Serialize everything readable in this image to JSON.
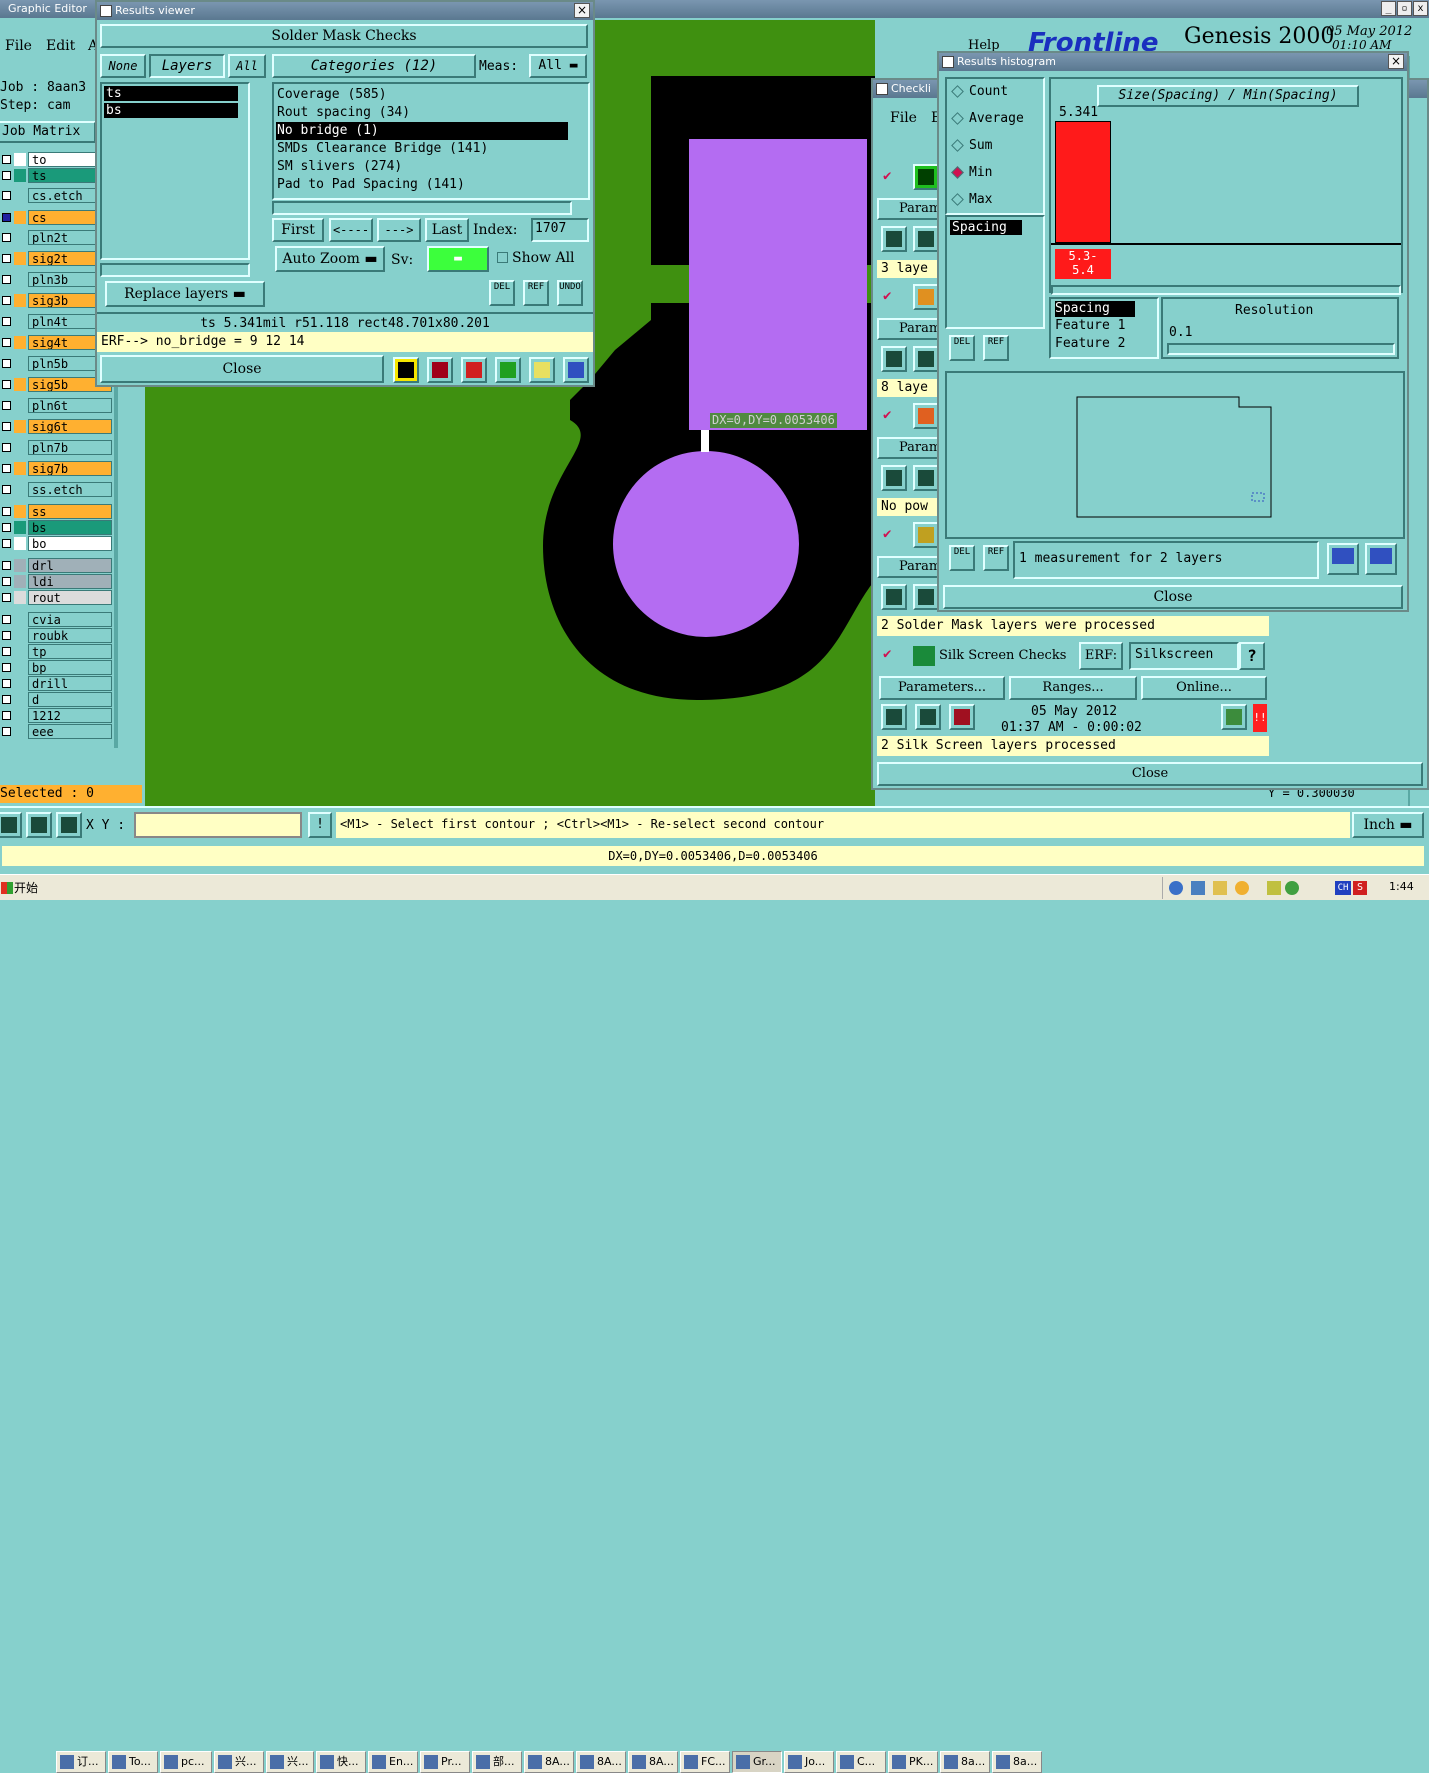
{
  "graphic_editor": {
    "title": "Graphic Editor",
    "menu": [
      "File",
      "Edit",
      "A"
    ],
    "help": "Help",
    "job_label": "Job : 8aan3",
    "step_label": "Step: cam",
    "job_matrix": "Job Matrix",
    "layers": [
      "to",
      "ts",
      "cs.etch",
      "cs",
      "pln2t",
      "sig2t",
      "pln3b",
      "sig3b",
      "pln4t",
      "sig4t",
      "pln5b",
      "sig5b",
      "pln6t",
      "sig6t",
      "pln7b",
      "sig7b",
      "ss.etch",
      "ss",
      "bs",
      "bo",
      "drl",
      "ldi",
      "rout",
      "cvia",
      "roubk",
      "tp",
      "bp",
      "drill",
      "d",
      "1212",
      "eee"
    ],
    "selected_label": "Selected : 0",
    "xy_label": "X Y :",
    "hint": "<M1> - Select first contour ; <Ctrl><M1> - Re-select second contour",
    "units": "Inch",
    "status": "DX=0,DY=0.0053406,D=0.0053406",
    "measure_label": "DX=0,DY=0.0053406",
    "y_readout": "Y = 0.300030",
    "brand": "Frontline",
    "product": "Genesis 2000",
    "date": "05 May 2012",
    "time": "01:10 AM"
  },
  "results_viewer": {
    "title": "Results viewer",
    "heading": "Solder Mask Checks",
    "tabs": {
      "none": "None",
      "layers": "Layers",
      "all": "All"
    },
    "layer_list": [
      "ts",
      "bs"
    ],
    "categories_title": "Categories (12)",
    "meas_label": "Meas:",
    "meas_value": "All",
    "categories": [
      "Coverage (585)",
      "Rout spacing (34)",
      "No bridge (1)",
      "SMDs Clearance Bridge (141)",
      "SM slivers (274)",
      "Pad to Pad Spacing (141)"
    ],
    "nav": {
      "first": "First",
      "prev": "<----",
      "next": "--->",
      "last": "Last",
      "index_label": "Index:",
      "index_value": "1707"
    },
    "auto_zoom": "Auto Zoom",
    "sv_label": "Sv:",
    "show_all": "Show All",
    "replace_layers": "Replace layers",
    "del": "DEL",
    "ref": "REF",
    "undo": "UNDO",
    "info": "ts 5.341mil  r51.118  rect48.701x80.201",
    "erf": "ERF--> no_bridge = 9 12 14",
    "close": "Close"
  },
  "checklist": {
    "title": "Checkli",
    "menu": [
      "File",
      "E"
    ],
    "param": "Param",
    "rows": [
      "3 laye",
      "8 laye",
      "No pow"
    ],
    "sm_status": "2 Solder Mask layers were processed",
    "silk": {
      "label": "Silk Screen Checks",
      "erf": "ERF:",
      "erf_value": "Silkscreen",
      "q": "?"
    },
    "buttons": {
      "parameters": "Parameters...",
      "ranges": "Ranges...",
      "online": "Online..."
    },
    "run_date": "05 May 2012",
    "run_time": "01:37 AM - 0:00:02",
    "ss_status": "2 Silk Screen layers processed",
    "close": "Close"
  },
  "histogram": {
    "title": "Results histogram",
    "options": [
      "Count",
      "Average",
      "Sum",
      "Min",
      "Max"
    ],
    "selected_option": "Min",
    "header": "Size(Spacing) / Min(Spacing)",
    "bar_value": "5.341",
    "bar_label": "5.3-\n5.4",
    "list": [
      "Spacing"
    ],
    "features": [
      "Spacing",
      "Feature 1",
      "Feature 2"
    ],
    "resolution_label": "Resolution",
    "resolution_value": "0.1",
    "del": "DEL",
    "ref": "REF",
    "measurement": "1 measurement for 2 layers",
    "close": "Close"
  },
  "taskbar": {
    "start": "开始",
    "items": [
      "订...",
      "To...",
      "pc...",
      "兴...",
      "兴...",
      "快...",
      "En...",
      "Pr...",
      "部...",
      "8A...",
      "8A...",
      "8A...",
      "FC...",
      "Gr...",
      "Jo...",
      "C...",
      "PK...",
      "8a...",
      "8a..."
    ],
    "clock": "1:44"
  },
  "colors": {
    "panel": "#86d0cc",
    "board": "#3f9010",
    "pad": "#b46cf2",
    "mask": "#000000",
    "bar": "#ff1a1a",
    "highlight": "#ffffc4"
  }
}
